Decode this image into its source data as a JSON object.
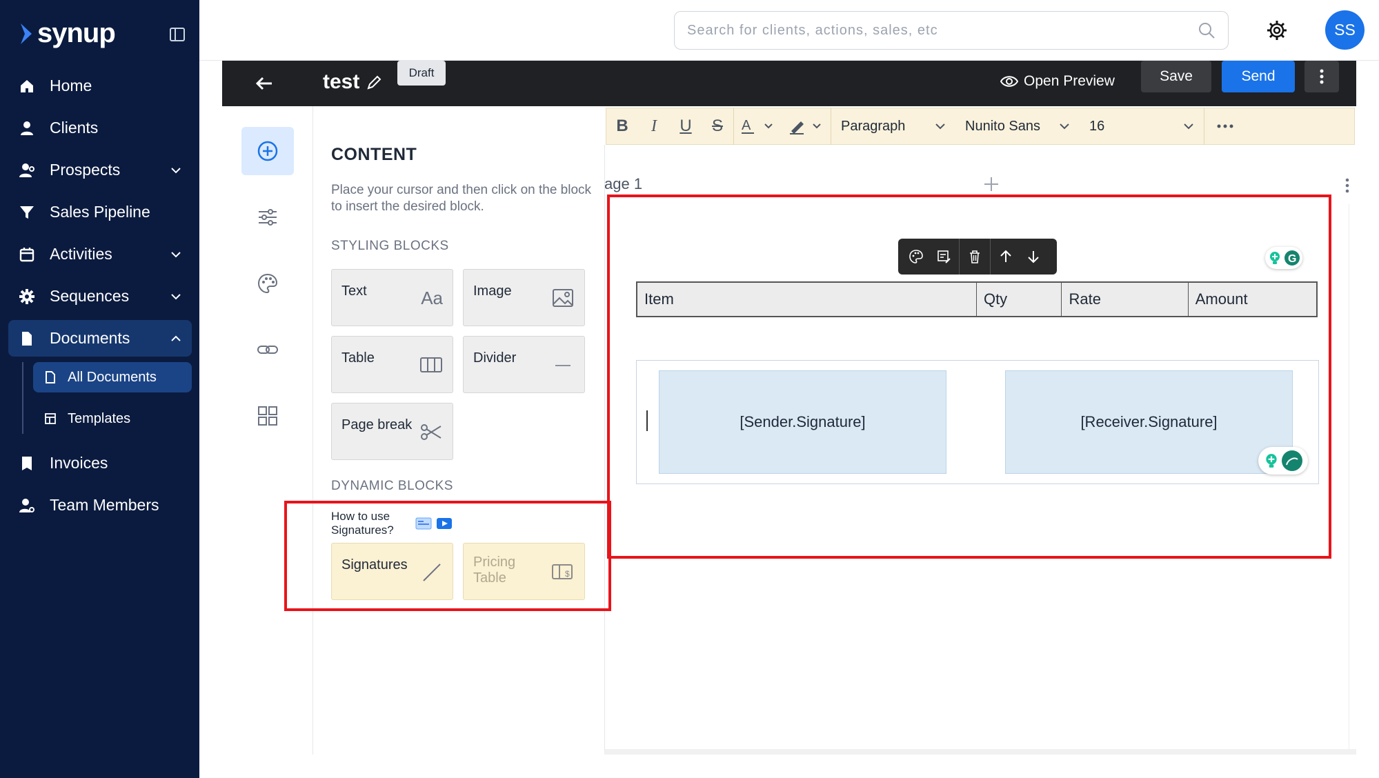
{
  "app": {
    "brand": "synup"
  },
  "sidebar": {
    "items": [
      {
        "label": "Home"
      },
      {
        "label": "Clients"
      },
      {
        "label": "Prospects"
      },
      {
        "label": "Sales Pipeline"
      },
      {
        "label": "Activities"
      },
      {
        "label": "Sequences"
      },
      {
        "label": "Documents"
      },
      {
        "label": "Invoices"
      },
      {
        "label": "Team Members"
      }
    ],
    "documents_sub": [
      {
        "label": "All Documents"
      },
      {
        "label": "Templates"
      }
    ]
  },
  "topbar": {
    "search_placeholder": "Search for clients, actions, sales, etc",
    "avatar_initials": "SS"
  },
  "docbar": {
    "title": "test",
    "status": "Draft",
    "open_preview": "Open Preview",
    "save": "Save",
    "send": "Send"
  },
  "content_panel": {
    "title": "CONTENT",
    "help": "Place your cursor and then click on the block to insert the desired block.",
    "styling_label": "STYLING BLOCKS",
    "styling_blocks": [
      {
        "label": "Text"
      },
      {
        "label": "Image"
      },
      {
        "label": "Table"
      },
      {
        "label": "Divider"
      },
      {
        "label": "Page break"
      }
    ],
    "dynamic_label": "DYNAMIC BLOCKS",
    "howto": "How to use Signatures?",
    "dynamic_blocks": [
      {
        "label": "Signatures"
      },
      {
        "label": "Pricing Table"
      }
    ]
  },
  "editor_toolbar": {
    "paragraph": "Paragraph",
    "font": "Nunito Sans",
    "size": "16"
  },
  "canvas": {
    "page_label": "age 1",
    "table_headers": [
      "Item",
      "Qty",
      "Rate",
      "Amount"
    ],
    "sender_signature": "[Sender.Signature]",
    "receiver_signature": "[Receiver.Signature]"
  },
  "colors": {
    "sidebar_bg": "#0b1b3f",
    "accent": "#1a73e8",
    "highlight": "#e8141b"
  }
}
